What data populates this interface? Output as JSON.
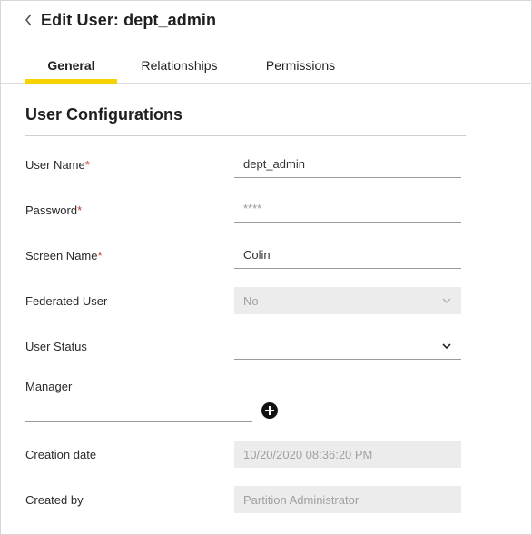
{
  "header": {
    "title": "Edit User: dept_admin"
  },
  "tabs": [
    {
      "label": "General",
      "active": true
    },
    {
      "label": "Relationships",
      "active": false
    },
    {
      "label": "Permissions",
      "active": false
    }
  ],
  "section": {
    "title": "User Configurations"
  },
  "fields": {
    "user_name": {
      "label": "User Name",
      "required_mark": "*",
      "value": "dept_admin"
    },
    "password": {
      "label": "Password",
      "required_mark": "*",
      "value": "****"
    },
    "screen_name": {
      "label": "Screen Name",
      "required_mark": "*",
      "value": "Colin"
    },
    "federated_user": {
      "label": "Federated User",
      "value": "No"
    },
    "user_status": {
      "label": "User Status",
      "value": ""
    },
    "manager": {
      "label": "Manager",
      "value": ""
    },
    "creation_date": {
      "label": "Creation date",
      "value": "10/20/2020 08:36:20 PM"
    },
    "created_by": {
      "label": "Created by",
      "value": "Partition Administrator"
    }
  },
  "icons": {
    "back": "chevron-left-icon",
    "dropdown": "chevron-down-icon",
    "add": "plus-circle-icon"
  },
  "colors": {
    "accent": "#f5d200",
    "required": "#c0392b",
    "disabled_bg": "#ececec"
  }
}
